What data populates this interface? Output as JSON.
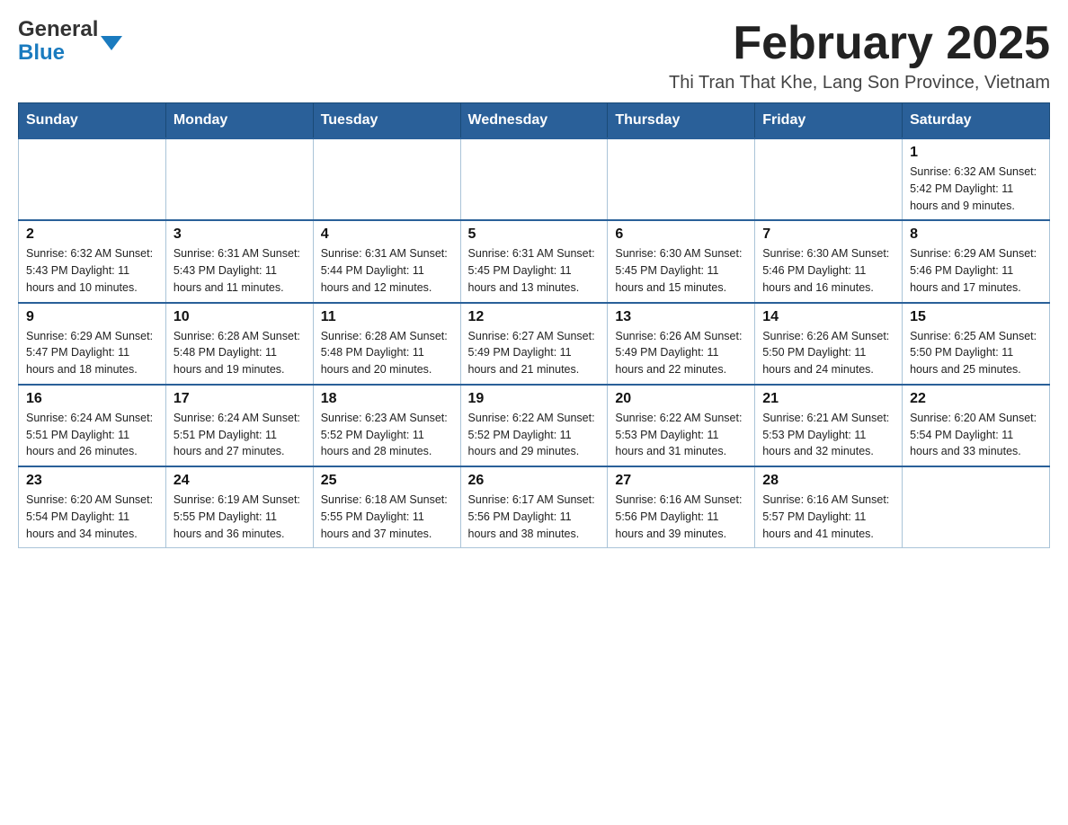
{
  "header": {
    "logo_general": "General",
    "logo_blue": "Blue",
    "title": "February 2025",
    "subtitle": "Thi Tran That Khe, Lang Son Province, Vietnam"
  },
  "weekdays": [
    "Sunday",
    "Monday",
    "Tuesday",
    "Wednesday",
    "Thursday",
    "Friday",
    "Saturday"
  ],
  "weeks": [
    [
      {
        "day": "",
        "info": ""
      },
      {
        "day": "",
        "info": ""
      },
      {
        "day": "",
        "info": ""
      },
      {
        "day": "",
        "info": ""
      },
      {
        "day": "",
        "info": ""
      },
      {
        "day": "",
        "info": ""
      },
      {
        "day": "1",
        "info": "Sunrise: 6:32 AM\nSunset: 5:42 PM\nDaylight: 11 hours and 9 minutes."
      }
    ],
    [
      {
        "day": "2",
        "info": "Sunrise: 6:32 AM\nSunset: 5:43 PM\nDaylight: 11 hours and 10 minutes."
      },
      {
        "day": "3",
        "info": "Sunrise: 6:31 AM\nSunset: 5:43 PM\nDaylight: 11 hours and 11 minutes."
      },
      {
        "day": "4",
        "info": "Sunrise: 6:31 AM\nSunset: 5:44 PM\nDaylight: 11 hours and 12 minutes."
      },
      {
        "day": "5",
        "info": "Sunrise: 6:31 AM\nSunset: 5:45 PM\nDaylight: 11 hours and 13 minutes."
      },
      {
        "day": "6",
        "info": "Sunrise: 6:30 AM\nSunset: 5:45 PM\nDaylight: 11 hours and 15 minutes."
      },
      {
        "day": "7",
        "info": "Sunrise: 6:30 AM\nSunset: 5:46 PM\nDaylight: 11 hours and 16 minutes."
      },
      {
        "day": "8",
        "info": "Sunrise: 6:29 AM\nSunset: 5:46 PM\nDaylight: 11 hours and 17 minutes."
      }
    ],
    [
      {
        "day": "9",
        "info": "Sunrise: 6:29 AM\nSunset: 5:47 PM\nDaylight: 11 hours and 18 minutes."
      },
      {
        "day": "10",
        "info": "Sunrise: 6:28 AM\nSunset: 5:48 PM\nDaylight: 11 hours and 19 minutes."
      },
      {
        "day": "11",
        "info": "Sunrise: 6:28 AM\nSunset: 5:48 PM\nDaylight: 11 hours and 20 minutes."
      },
      {
        "day": "12",
        "info": "Sunrise: 6:27 AM\nSunset: 5:49 PM\nDaylight: 11 hours and 21 minutes."
      },
      {
        "day": "13",
        "info": "Sunrise: 6:26 AM\nSunset: 5:49 PM\nDaylight: 11 hours and 22 minutes."
      },
      {
        "day": "14",
        "info": "Sunrise: 6:26 AM\nSunset: 5:50 PM\nDaylight: 11 hours and 24 minutes."
      },
      {
        "day": "15",
        "info": "Sunrise: 6:25 AM\nSunset: 5:50 PM\nDaylight: 11 hours and 25 minutes."
      }
    ],
    [
      {
        "day": "16",
        "info": "Sunrise: 6:24 AM\nSunset: 5:51 PM\nDaylight: 11 hours and 26 minutes."
      },
      {
        "day": "17",
        "info": "Sunrise: 6:24 AM\nSunset: 5:51 PM\nDaylight: 11 hours and 27 minutes."
      },
      {
        "day": "18",
        "info": "Sunrise: 6:23 AM\nSunset: 5:52 PM\nDaylight: 11 hours and 28 minutes."
      },
      {
        "day": "19",
        "info": "Sunrise: 6:22 AM\nSunset: 5:52 PM\nDaylight: 11 hours and 29 minutes."
      },
      {
        "day": "20",
        "info": "Sunrise: 6:22 AM\nSunset: 5:53 PM\nDaylight: 11 hours and 31 minutes."
      },
      {
        "day": "21",
        "info": "Sunrise: 6:21 AM\nSunset: 5:53 PM\nDaylight: 11 hours and 32 minutes."
      },
      {
        "day": "22",
        "info": "Sunrise: 6:20 AM\nSunset: 5:54 PM\nDaylight: 11 hours and 33 minutes."
      }
    ],
    [
      {
        "day": "23",
        "info": "Sunrise: 6:20 AM\nSunset: 5:54 PM\nDaylight: 11 hours and 34 minutes."
      },
      {
        "day": "24",
        "info": "Sunrise: 6:19 AM\nSunset: 5:55 PM\nDaylight: 11 hours and 36 minutes."
      },
      {
        "day": "25",
        "info": "Sunrise: 6:18 AM\nSunset: 5:55 PM\nDaylight: 11 hours and 37 minutes."
      },
      {
        "day": "26",
        "info": "Sunrise: 6:17 AM\nSunset: 5:56 PM\nDaylight: 11 hours and 38 minutes."
      },
      {
        "day": "27",
        "info": "Sunrise: 6:16 AM\nSunset: 5:56 PM\nDaylight: 11 hours and 39 minutes."
      },
      {
        "day": "28",
        "info": "Sunrise: 6:16 AM\nSunset: 5:57 PM\nDaylight: 11 hours and 41 minutes."
      },
      {
        "day": "",
        "info": ""
      }
    ]
  ]
}
